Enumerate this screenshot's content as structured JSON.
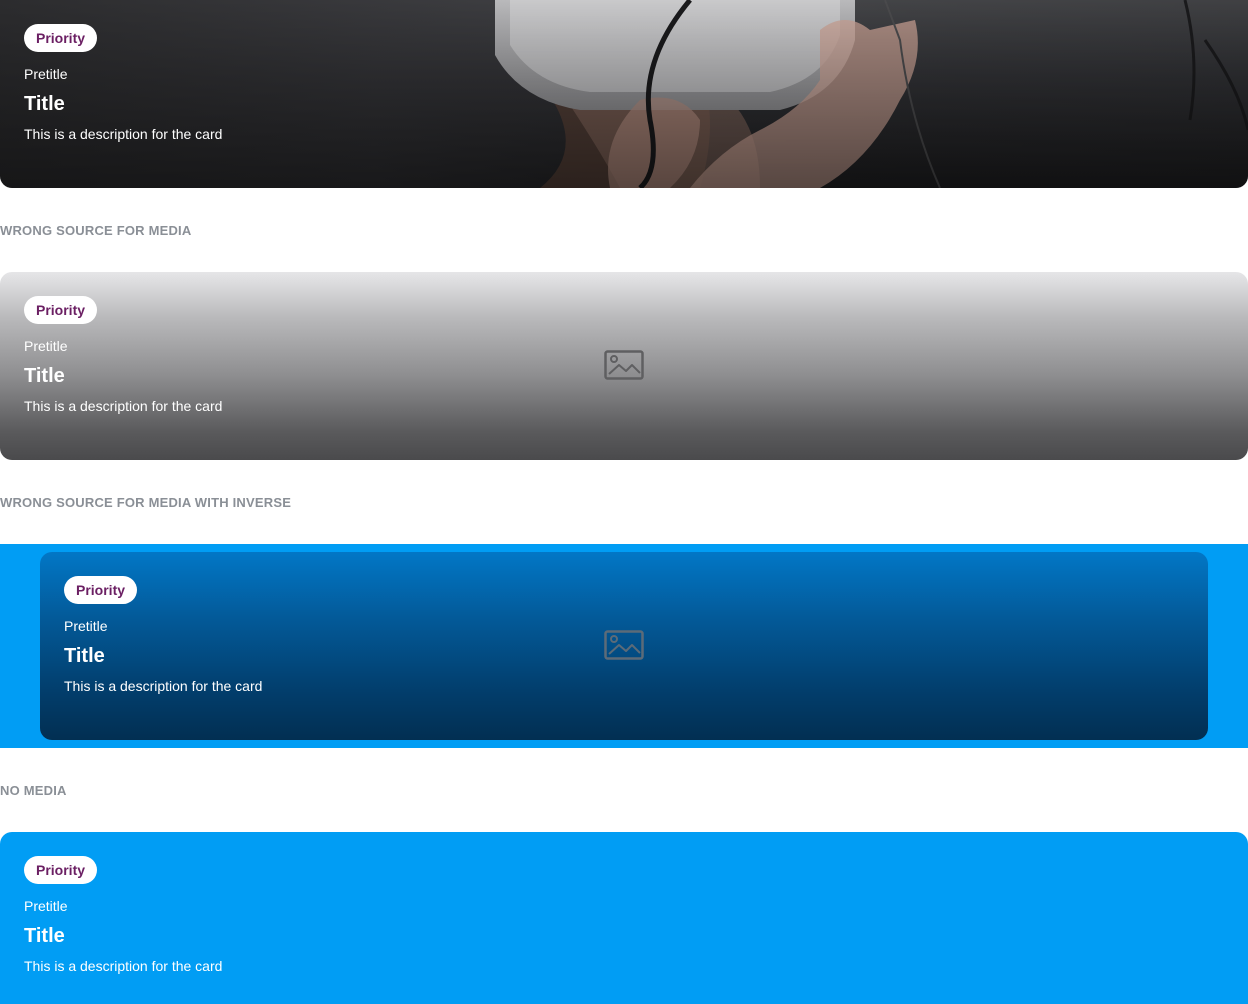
{
  "cards": [
    {
      "chip": "Priority",
      "pretitle": "Pretitle",
      "title": "Title",
      "description": "This is a description for the card"
    },
    {
      "chip": "Priority",
      "pretitle": "Pretitle",
      "title": "Title",
      "description": "This is a description for the card",
      "media_icon": "image-placeholder-icon"
    },
    {
      "chip": "Priority",
      "pretitle": "Pretitle",
      "title": "Title",
      "description": "This is a description for the card",
      "media_icon": "image-placeholder-icon"
    },
    {
      "chip": "Priority",
      "pretitle": "Pretitle",
      "title": "Title",
      "description": "This is a description for the card"
    }
  ],
  "sections": {
    "wrong_source": "WRONG SOURCE FOR MEDIA",
    "wrong_source_inverse": "WRONG SOURCE FOR MEDIA WITH INVERSE",
    "no_media": "NO MEDIA"
  },
  "colors": {
    "chip_text": "#6b1f63",
    "inverse_background": "#019df4",
    "section_label": "#8a8f96"
  }
}
